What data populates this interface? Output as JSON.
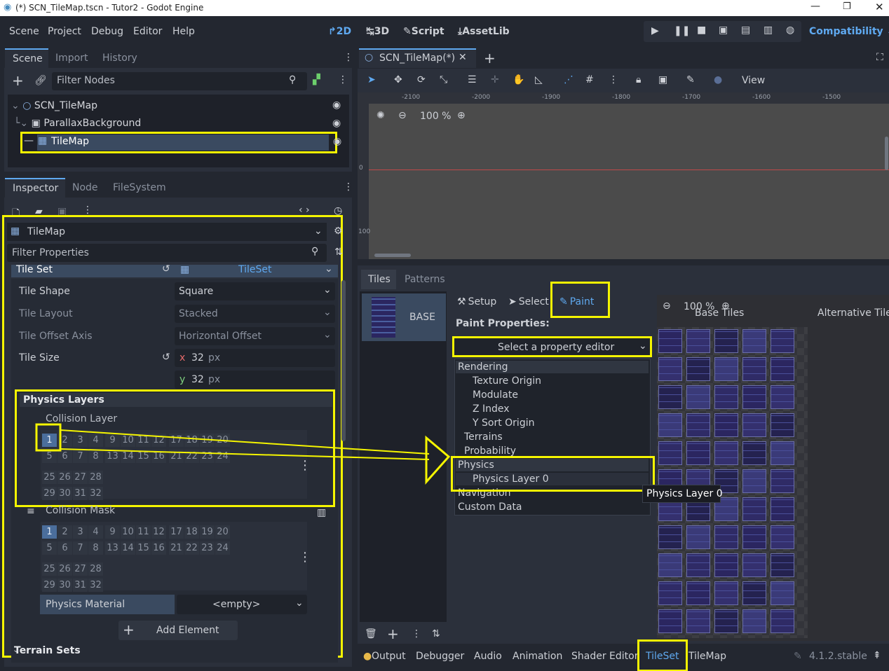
{
  "window": {
    "title": "(*) SCN_TileMap.tscn - Tutor2 - Godot Engine"
  },
  "menu": [
    "Scene",
    "Project",
    "Debug",
    "Editor",
    "Help"
  ],
  "workspaces": {
    "w2d": "2D",
    "w3d": "3D",
    "script": "Script",
    "assetlib": "AssetLib"
  },
  "renderer": "Compatibility",
  "scene_dock": {
    "tabs": [
      "Scene",
      "Import",
      "History"
    ],
    "filter_placeholder": "Filter Nodes",
    "nodes": [
      "SCN_TileMap",
      "ParallaxBackground",
      "TileMap"
    ]
  },
  "inspector_dock": {
    "tabs": [
      "Inspector",
      "Node",
      "FileSystem"
    ],
    "object": "TileMap",
    "filter_placeholder": "Filter Properties"
  },
  "props": {
    "tile_set_label": "Tile Set",
    "tile_set_value": "TileSet",
    "tile_shape_label": "Tile Shape",
    "tile_shape_value": "Square",
    "tile_layout_label": "Tile Layout",
    "tile_layout_value": "Stacked",
    "tile_offset_label": "Tile Offset Axis",
    "tile_offset_value": "Horizontal Offset",
    "tile_size_label": "Tile Size",
    "x_label": "x",
    "x_value": "32",
    "y_label": "y",
    "y_value": "32",
    "unit": "px",
    "physics_layers": "Physics Layers",
    "collision_layer": "Collision Layer",
    "collision_mask": "Collision Mask",
    "physics_material_label": "Physics Material",
    "physics_material_value": "<empty>",
    "add_element": "Add Element",
    "terrain_sets": "Terrain Sets"
  },
  "layer_grid": {
    "rows": [
      [
        "1",
        "2",
        "3",
        "4",
        "9",
        "10",
        "11",
        "12",
        "17",
        "18",
        "19",
        "20"
      ],
      [
        "5",
        "6",
        "7",
        "8",
        "13",
        "14",
        "15",
        "16",
        "21",
        "22",
        "23",
        "24"
      ],
      [
        "25",
        "26",
        "27",
        "28"
      ],
      [
        "29",
        "30",
        "31",
        "32"
      ]
    ]
  },
  "viewport": {
    "tab": "SCN_TileMap(*)",
    "view_menu": "View",
    "zoom": "100 %",
    "ruler": [
      "-2100",
      "-2000",
      "-1900",
      "-1800",
      "-1700",
      "-1600",
      "-1500"
    ],
    "vruler": [
      "0",
      "100"
    ]
  },
  "tileset_editor": {
    "tabs": [
      "Tiles",
      "Patterns"
    ],
    "source": "BASE",
    "modes": {
      "setup": "Setup",
      "select": "Select",
      "paint": "Paint"
    },
    "paint_props": "Paint Properties:",
    "property_editor": "Select a property editor",
    "menu": {
      "rendering": "Rendering",
      "texture_origin": "Texture Origin",
      "modulate": "Modulate",
      "z_index": "Z Index",
      "y_sort": "Y Sort Origin",
      "terrains": "Terrains",
      "probability": "Probability",
      "physics": "Physics",
      "physics_layer": "Physics Layer 0",
      "navigation": "Navigation",
      "custom_data": "Custom Data"
    },
    "tooltip": "Physics Layer 0",
    "atlas_zoom": "100 %",
    "base_tiles": "Base Tiles",
    "alternative_tiles": "Alternative Tiles"
  },
  "bottom": {
    "tabs": [
      "Output",
      "Debugger",
      "Audio",
      "Animation",
      "Shader Editor",
      "TileSet",
      "TileMap"
    ],
    "version": "4.1.2.stable"
  },
  "colors": {
    "highlight": "#f5f500",
    "accent": "#5fa9f0",
    "bg": "#232730"
  }
}
